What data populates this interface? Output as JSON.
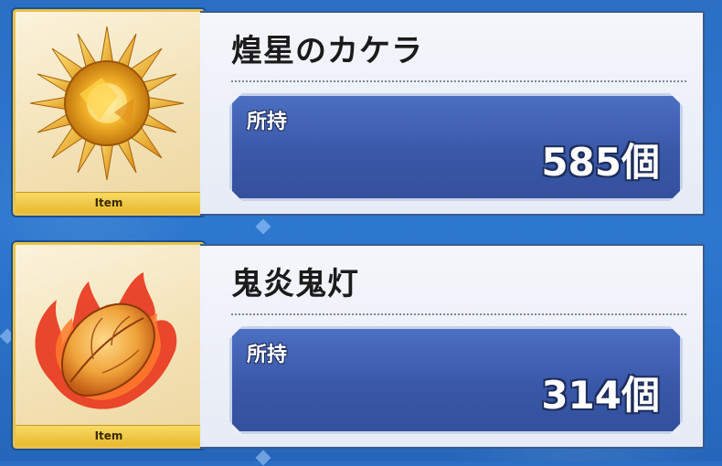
{
  "items": [
    {
      "name": "煌星のカケラ",
      "icon_label": "Item",
      "owned_label": "所持",
      "owned_count": "585個",
      "icon": "golden-star-shard-icon"
    },
    {
      "name": "鬼炎鬼灯",
      "icon_label": "Item",
      "owned_label": "所持",
      "owned_count": "314個",
      "icon": "flaming-lantern-plant-icon"
    }
  ],
  "colors": {
    "background": "#2d78cf",
    "panel": "#eef1f8",
    "owned_box": "#3f5eb0",
    "icon_frame": "#e8c24a"
  }
}
